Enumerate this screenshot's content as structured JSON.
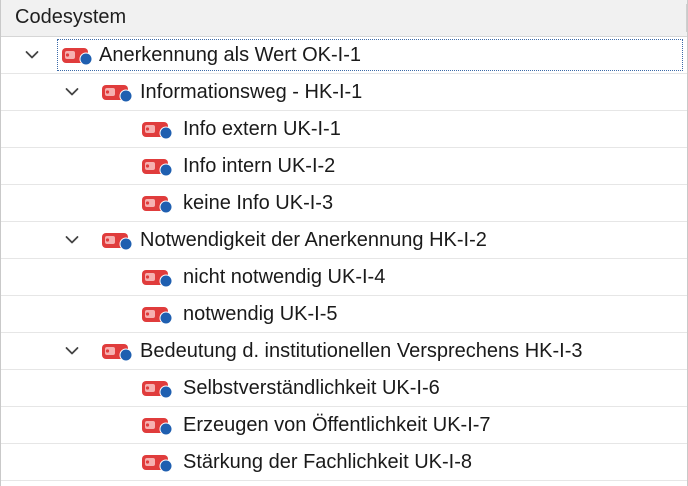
{
  "header": {
    "title": "Codesystem"
  },
  "colors": {
    "code_red": "#e03c3c",
    "code_red_light": "#f6b1b1",
    "code_blue": "#1f5fb0"
  },
  "tree": [
    {
      "label": "Anerkennung als Wert OK-I-1",
      "level": 0,
      "expanded": true,
      "selected": true
    },
    {
      "label": "Informationsweg - HK-I-1",
      "level": 1,
      "expanded": true
    },
    {
      "label": "Info extern UK-I-1",
      "level": 2
    },
    {
      "label": "Info intern UK-I-2",
      "level": 2
    },
    {
      "label": "keine Info UK-I-3",
      "level": 2
    },
    {
      "label": "Notwendigkeit der Anerkennung HK-I-2",
      "level": 1,
      "expanded": true
    },
    {
      "label": "nicht notwendig UK-I-4",
      "level": 2
    },
    {
      "label": "notwendig UK-I-5",
      "level": 2
    },
    {
      "label": "Bedeutung d. institutionellen Versprechens HK-I-3",
      "level": 1,
      "expanded": true
    },
    {
      "label": "Selbstverständlichkeit UK-I-6",
      "level": 2
    },
    {
      "label": "Erzeugen von Öffentlichkeit UK-I-7",
      "level": 2
    },
    {
      "label": "Stärkung der Fachlichkeit UK-I-8",
      "level": 2
    }
  ]
}
